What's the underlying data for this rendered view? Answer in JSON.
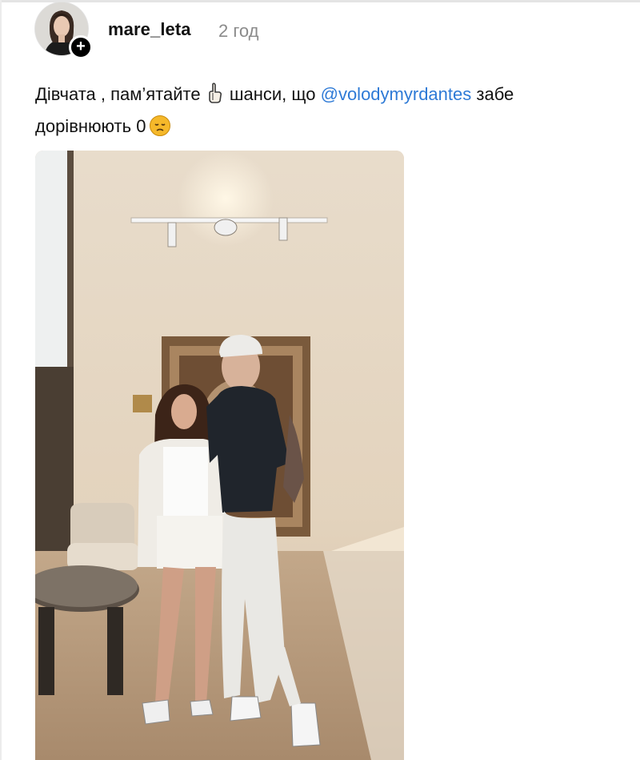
{
  "post": {
    "username": "mare_leta",
    "timestamp": "2 год",
    "text_part1": "Дівчата , пам’ятайте",
    "text_part2": "шанси, що",
    "mention": "@volodymyrdantes",
    "text_part3": "забе",
    "text_line2": "дорівнюють 0"
  },
  "icons": {
    "follow": "plus-icon",
    "emoji1": "index-pointing-up-emoji",
    "emoji2": "sad-face-emoji"
  },
  "colors": {
    "mention": "#2e7ad6",
    "timestamp": "#8a8a8a",
    "text": "#111111"
  }
}
